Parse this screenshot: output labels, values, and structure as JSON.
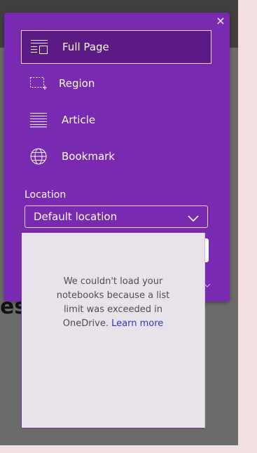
{
  "clipper": {
    "close_glyph": "×",
    "modes": [
      {
        "label": "Full Page",
        "icon": "full-page-icon",
        "selected": true
      },
      {
        "label": "Region",
        "icon": "region-icon",
        "selected": false
      },
      {
        "label": "Article",
        "icon": "article-icon",
        "selected": false
      },
      {
        "label": "Bookmark",
        "icon": "globe-icon",
        "selected": false
      }
    ],
    "location": {
      "label": "Location",
      "selected": "Default location"
    }
  },
  "dropdown": {
    "message": "We couldn't load your notebooks because a list limit was exceeded in OneDrive.",
    "link": "Learn more"
  },
  "background": {
    "partial_text": "es"
  },
  "colors": {
    "accent": "#7a2ab0",
    "selected": "#5b1a84",
    "link": "#2b35c9"
  }
}
